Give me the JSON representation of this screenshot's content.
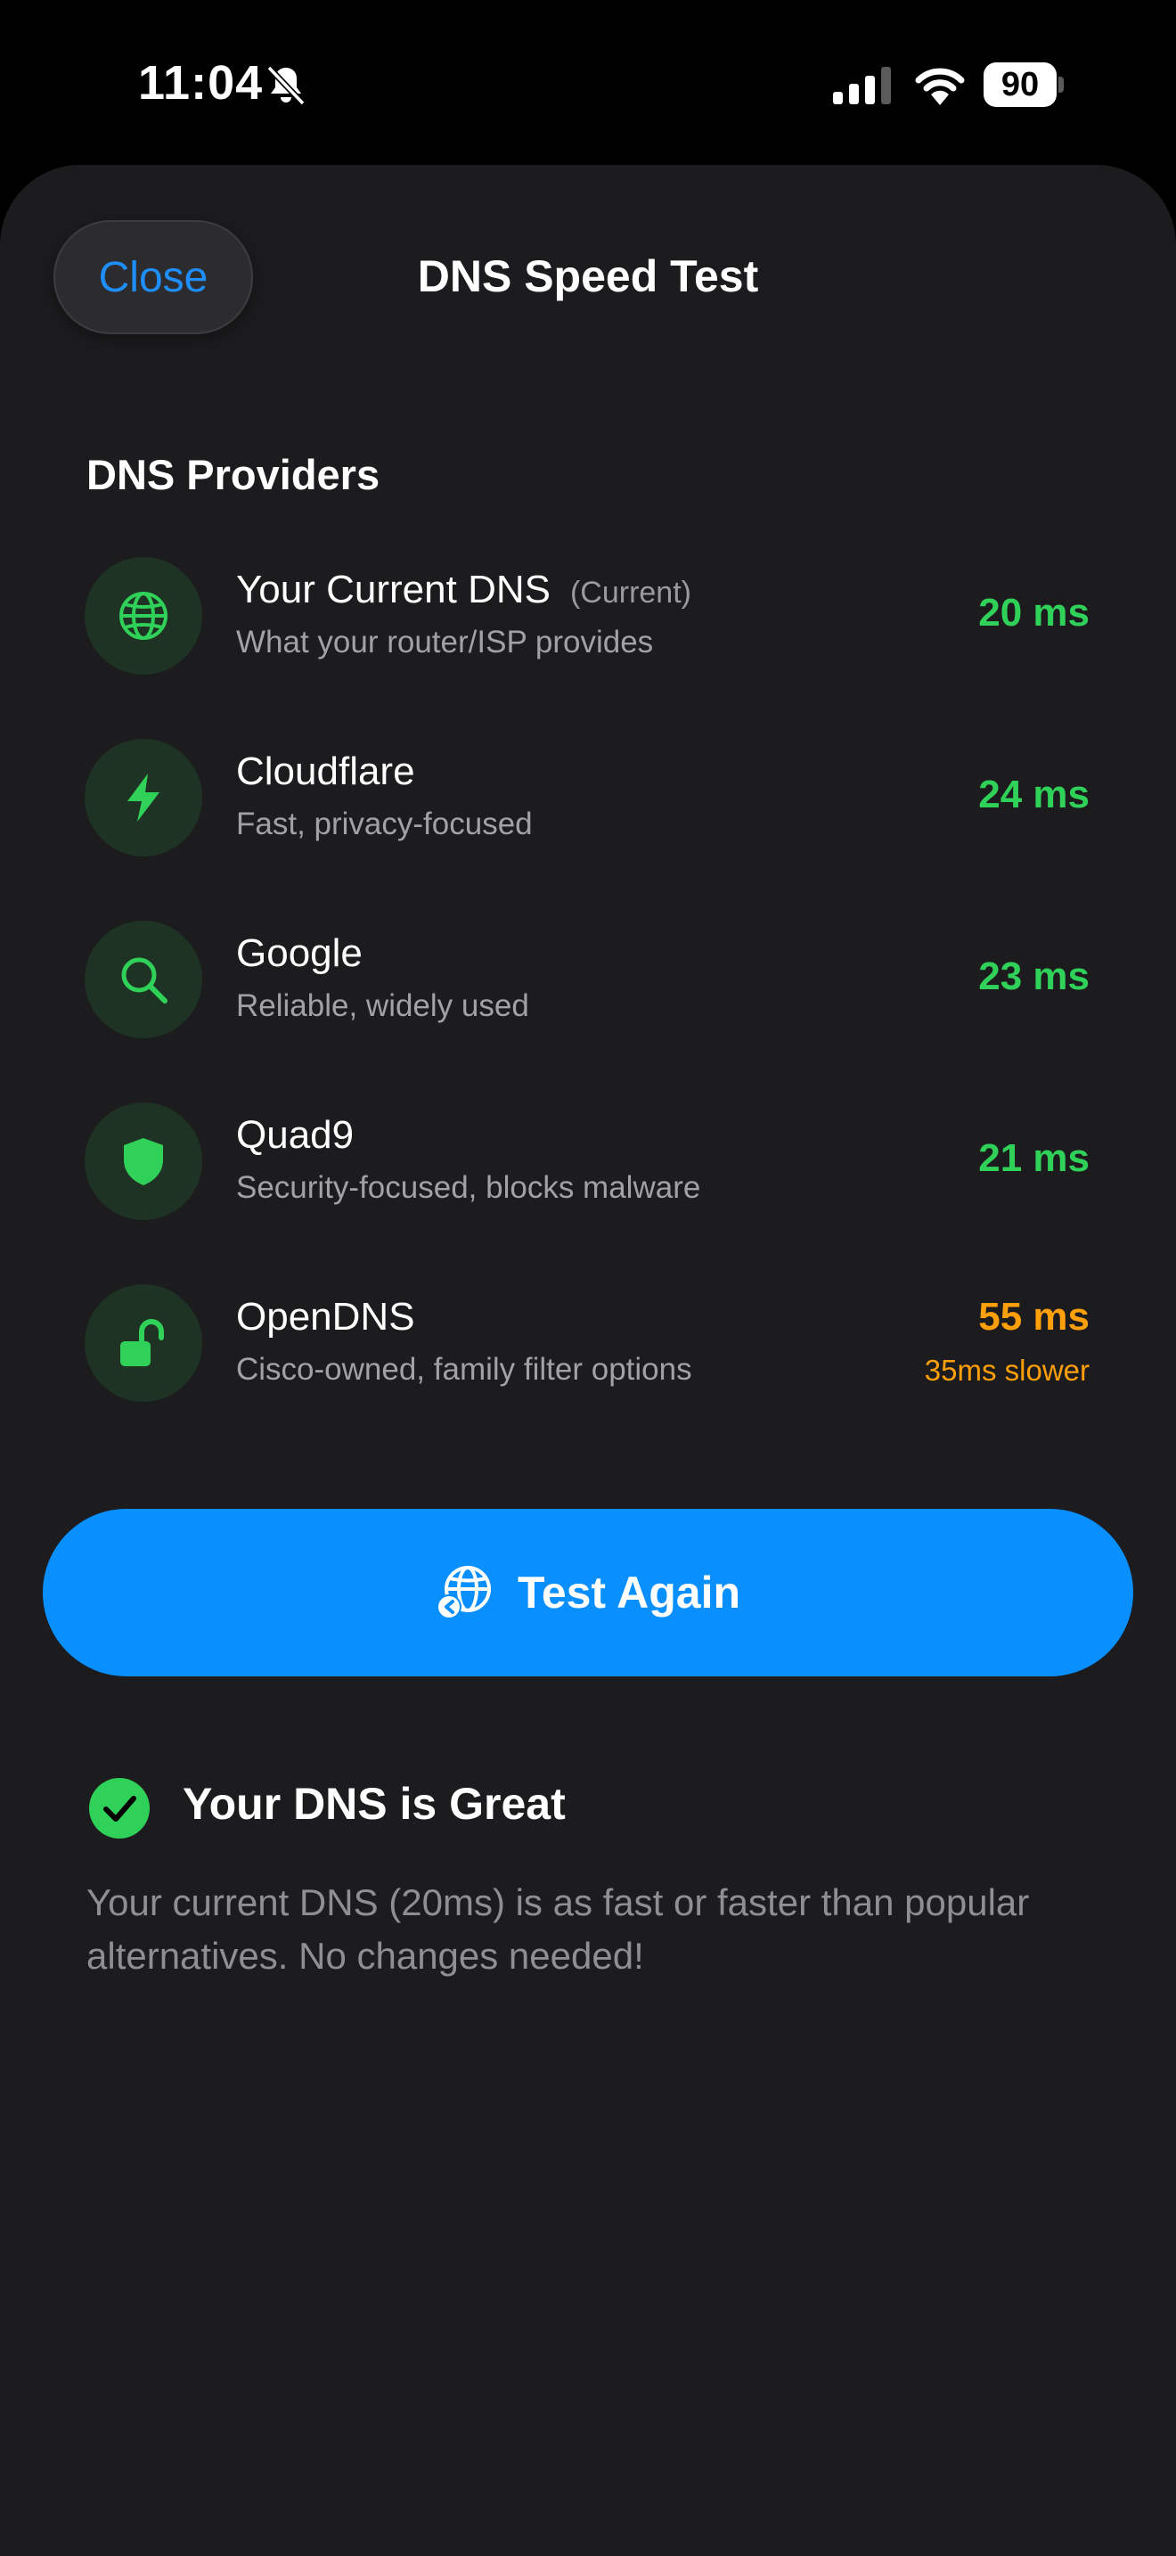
{
  "status_bar": {
    "time": "11:04",
    "battery": "90",
    "icons": [
      "bell-slash-icon",
      "cellular-signal-icon",
      "wifi-icon",
      "battery-icon"
    ]
  },
  "header": {
    "close_label": "Close",
    "title": "DNS Speed Test"
  },
  "providers_section": {
    "title": "DNS Providers",
    "items": [
      {
        "name": "Your Current DNS",
        "tag": "(Current)",
        "description": "What your router/ISP provides",
        "latency": "20 ms",
        "diff": "",
        "icon": "globe-icon"
      },
      {
        "name": "Cloudflare",
        "tag": "",
        "description": "Fast, privacy-focused",
        "latency": "24 ms",
        "diff": "",
        "icon": "bolt-icon"
      },
      {
        "name": "Google",
        "tag": "",
        "description": "Reliable, widely used",
        "latency": "23 ms",
        "diff": "",
        "icon": "magnifying-glass-icon"
      },
      {
        "name": "Quad9",
        "tag": "",
        "description": "Security-focused, blocks malware",
        "latency": "21 ms",
        "diff": "",
        "icon": "shield-icon"
      },
      {
        "name": "OpenDNS",
        "tag": "",
        "description": "Cisco-owned, family filter options",
        "latency": "55 ms",
        "diff": "35ms slower",
        "icon": "lock-open-icon"
      }
    ]
  },
  "actions": {
    "test_again_label": "Test Again",
    "icon": "globe-refresh-icon"
  },
  "result": {
    "title": "Your DNS is Great",
    "body": "Your current DNS (20ms) is as fast or faster than popular alternatives. No changes needed!",
    "icon": "checkmark-circle-icon"
  },
  "colors": {
    "accent_blue": "#0a8ffe",
    "good_green": "#30d158",
    "slow_orange": "#ff9f0a",
    "sheet_bg": "#1c1c1e",
    "icon_bg": "#1e3323"
  }
}
